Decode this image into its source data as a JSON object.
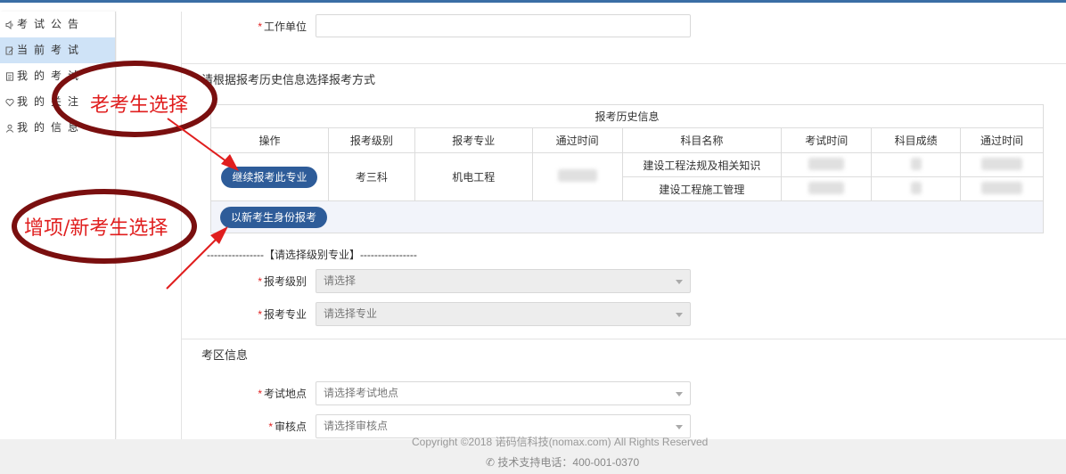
{
  "sidebar": {
    "items": [
      {
        "label": "考试公告",
        "icon": "speaker-icon",
        "active": false
      },
      {
        "label": "当前考试",
        "icon": "edit-icon",
        "active": true
      },
      {
        "label": "我的考试",
        "icon": "document-icon",
        "active": false
      },
      {
        "label": "我的关注",
        "icon": "heart-icon",
        "active": false
      },
      {
        "label": "我的信息",
        "icon": "user-icon",
        "active": false
      }
    ]
  },
  "form": {
    "work_unit_label": "工作单位",
    "work_unit_value": "",
    "required_mark": "*"
  },
  "history_section": {
    "title": "请根据报考历史信息选择报考方式",
    "table_caption": "报考历史信息",
    "headers": [
      "操作",
      "报考级别",
      "报考专业",
      "通过时间",
      "科目名称",
      "考试时间",
      "科目成绩",
      "通过时间"
    ],
    "level": "考三科",
    "major": "机电工程",
    "subjects": [
      "建设工程法规及相关知识",
      "建设工程施工管理"
    ],
    "continue_button": "继续报考此专业",
    "new_button": "以新考生身份报考"
  },
  "selection": {
    "divider_text": "----------------【请选择级别专业】----------------",
    "level_label": "报考级别",
    "level_placeholder": "请选择",
    "major_label": "报考专业",
    "major_placeholder": "请选择专业"
  },
  "exam_area": {
    "title": "考区信息",
    "location_label": "考试地点",
    "location_placeholder": "请选择考试地点",
    "review_label": "审核点",
    "review_placeholder": "请选择审核点"
  },
  "footer": {
    "copyright": "Copyright ©2018 诺码信科技(nomax.com) All Rights Reserved",
    "support": "技术支持电话：400-001-0370"
  },
  "annotations": {
    "old_candidate": "老考生选择",
    "new_candidate": "增项/新考生选择"
  },
  "colors": {
    "accent": "#2e5c99",
    "annotation": "#e01e1e",
    "ellipse": "#7a0f0f",
    "active_sidebar": "#cfe3f7"
  }
}
